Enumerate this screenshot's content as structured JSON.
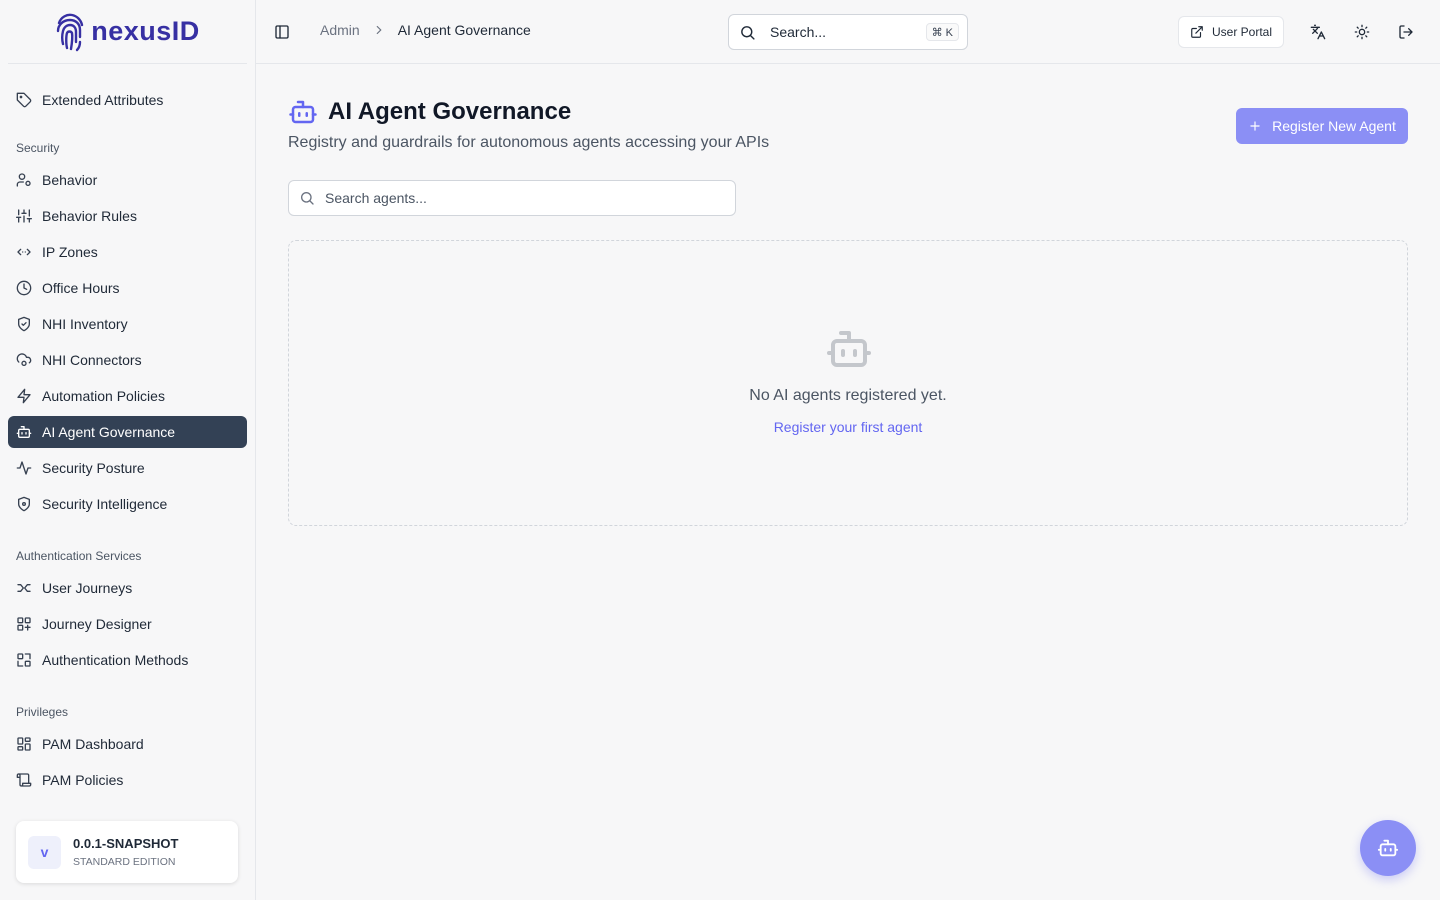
{
  "app": {
    "logo_text": "nexusID",
    "brand_color": "#3730a3",
    "accent_color": "#8b8ff5"
  },
  "sidebar": {
    "top_items": [
      {
        "label": "Extended Attributes",
        "icon": "tag-icon"
      }
    ],
    "sections": [
      {
        "label": "Security",
        "items": [
          {
            "label": "Behavior",
            "icon": "user-cog-icon"
          },
          {
            "label": "Behavior Rules",
            "icon": "sliders-icon"
          },
          {
            "label": "IP Zones",
            "icon": "code-arrows-icon"
          },
          {
            "label": "Office Hours",
            "icon": "clock-icon"
          },
          {
            "label": "NHI Inventory",
            "icon": "shield-check-icon"
          },
          {
            "label": "NHI Connectors",
            "icon": "cloud-cog-icon"
          },
          {
            "label": "Automation Policies",
            "icon": "zap-icon"
          },
          {
            "label": "AI Agent Governance",
            "icon": "bot-icon",
            "active": true
          },
          {
            "label": "Security Posture",
            "icon": "activity-icon"
          },
          {
            "label": "Security Intelligence",
            "icon": "shield-alert-icon"
          }
        ]
      },
      {
        "label": "Authentication Services",
        "items": [
          {
            "label": "User Journeys",
            "icon": "workflow-icon"
          },
          {
            "label": "Journey Designer",
            "icon": "layout-grid-icon"
          },
          {
            "label": "Authentication Methods",
            "icon": "scan-icon"
          }
        ]
      },
      {
        "label": "Privileges",
        "items": [
          {
            "label": "PAM Dashboard",
            "icon": "dashboard-icon"
          },
          {
            "label": "PAM Policies",
            "icon": "scroll-icon"
          }
        ]
      }
    ],
    "version": {
      "avatar": "v",
      "title": "0.0.1-SNAPSHOT",
      "edition": "STANDARD EDITION"
    }
  },
  "header": {
    "breadcrumb_root": "Admin",
    "breadcrumb_current": "AI Agent Governance",
    "search_placeholder": "Search...",
    "search_shortcut": "⌘ K",
    "user_portal_label": "User Portal"
  },
  "main": {
    "title": "AI Agent Governance",
    "subtitle": "Registry and guardrails for autonomous agents accessing your APIs",
    "register_button": "Register New Agent",
    "search_placeholder": "Search agents...",
    "empty_state": {
      "message": "No AI agents registered yet.",
      "link": "Register your first agent"
    }
  }
}
